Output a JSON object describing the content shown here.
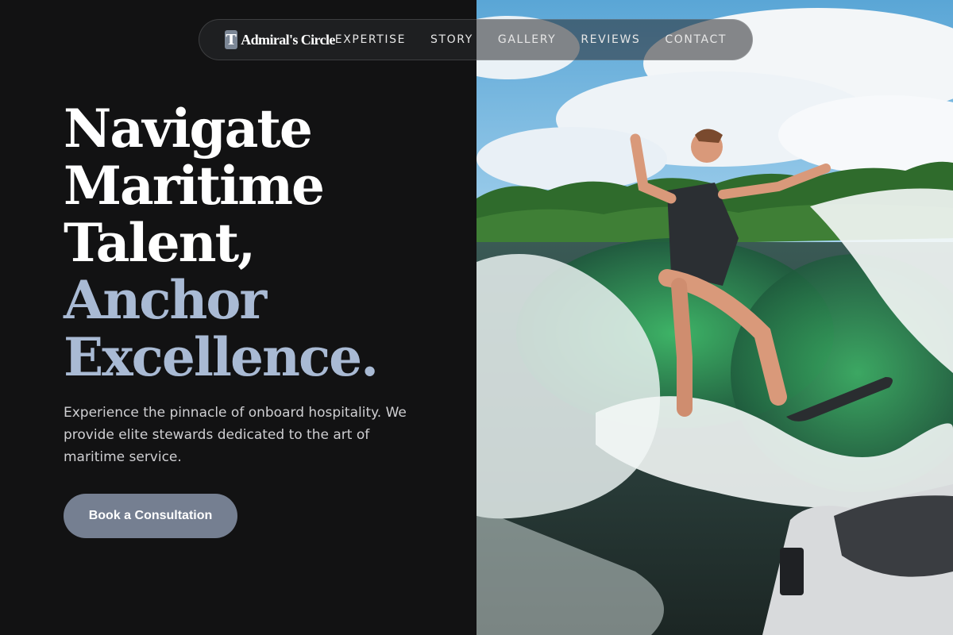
{
  "nav": {
    "logo_letter": "T",
    "brand": "Admiral's Circle",
    "links": [
      "EXPERTISE",
      "STORY",
      "GALLERY",
      "REVIEWS",
      "CONTACT"
    ]
  },
  "hero": {
    "headline_lines_white": [
      "Navigate",
      "Maritime",
      "Talent,"
    ],
    "headline_lines_accent": [
      "Anchor",
      "Excellence."
    ],
    "description": "Experience the pinnacle of onboard hospitality. We provide elite stewards dedicated to the art of maritime service.",
    "cta_label": "Book a Consultation",
    "image_subject": "wakesurfer-photo"
  },
  "colors": {
    "background": "#121213",
    "accent_text": "#a9bad4",
    "button": "#757f91",
    "logo_mark": "#7c8796"
  }
}
